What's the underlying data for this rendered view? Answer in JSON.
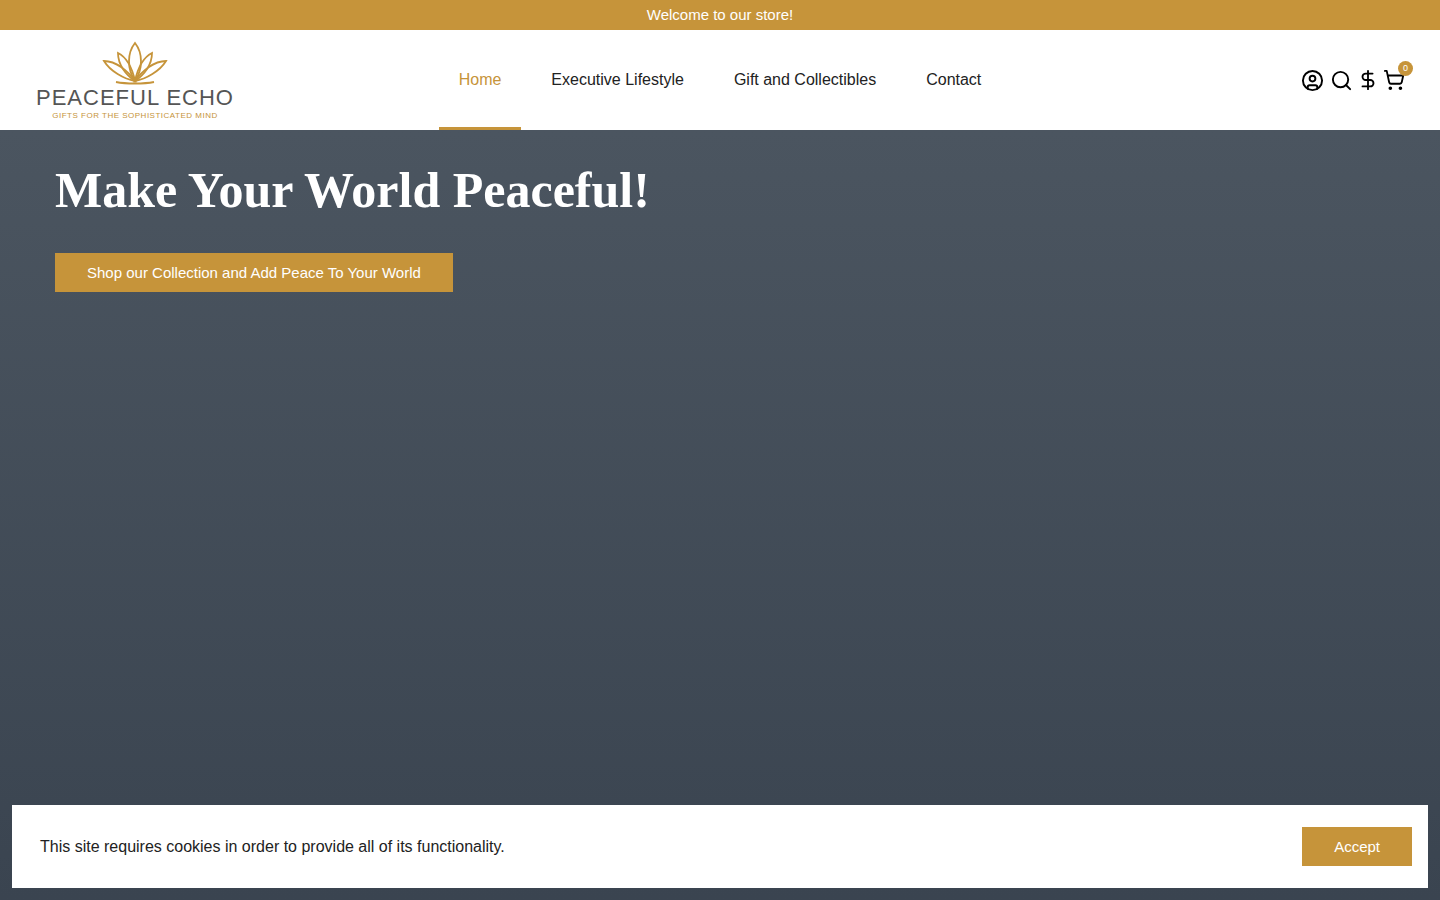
{
  "announcement": "Welcome to our store!",
  "logo": {
    "name": "PEACEFUL ECHO",
    "tagline": "GIFTS FOR THE SOPHISTICATED MIND"
  },
  "nav": [
    {
      "label": "Home",
      "selected": true
    },
    {
      "label": "Executive Lifestyle",
      "selected": false
    },
    {
      "label": "Gift and Collectibles",
      "selected": false
    },
    {
      "label": "Contact",
      "selected": false
    }
  ],
  "cart": {
    "count": "0"
  },
  "hero": {
    "title": "Make Your World Peaceful!",
    "button": "Shop our Collection and Add Peace To Your World"
  },
  "cookie_banner": {
    "message": "This site requires cookies in order to provide all of its functionality.",
    "button": "Accept"
  }
}
